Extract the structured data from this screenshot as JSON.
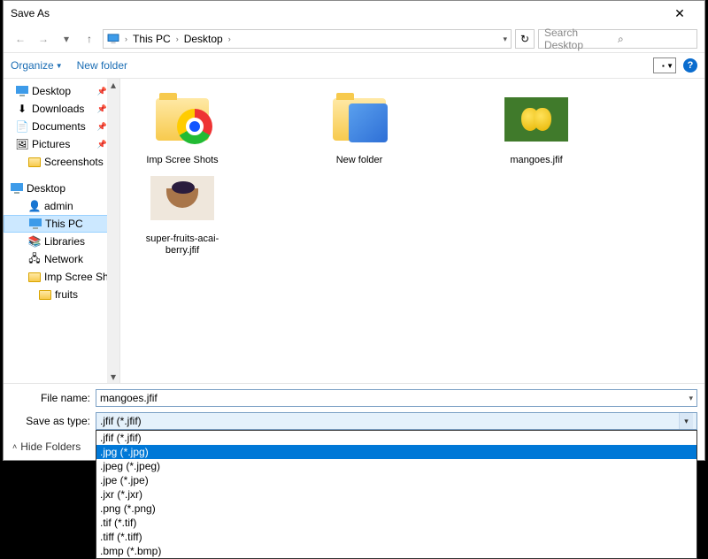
{
  "title": "Save As",
  "breadcrumb": {
    "root": "This PC",
    "leaf": "Desktop"
  },
  "search_placeholder": "Search Desktop",
  "cmdbar": {
    "organize": "Organize",
    "newfolder": "New folder"
  },
  "tree": {
    "desktop": "Desktop",
    "downloads": "Downloads",
    "documents": "Documents",
    "pictures": "Pictures",
    "screenshots": "Screenshots",
    "desktop2": "Desktop",
    "admin": "admin",
    "thispc": "This PC",
    "libraries": "Libraries",
    "network": "Network",
    "impscree": "Imp Scree Shots",
    "fruits": "fruits"
  },
  "files": {
    "f1": "Imp Scree Shots",
    "f2": "New folder",
    "f3": "mangoes.jfif",
    "f4": "super-fruits-acai-berry.jfif"
  },
  "labels": {
    "filename": "File name:",
    "saveastype": "Save as type:",
    "hidefolders": "Hide Folders"
  },
  "filename_value": "mangoes.jfif",
  "saveastype_value": ".jfif (*.jfif)",
  "type_options": [
    ".jfif (*.jfif)",
    ".jpg (*.jpg)",
    ".jpeg (*.jpeg)",
    ".jpe (*.jpe)",
    ".jxr (*.jxr)",
    ".png (*.png)",
    ".tif (*.tif)",
    ".tiff (*.tiff)",
    ".bmp (*.bmp)"
  ]
}
